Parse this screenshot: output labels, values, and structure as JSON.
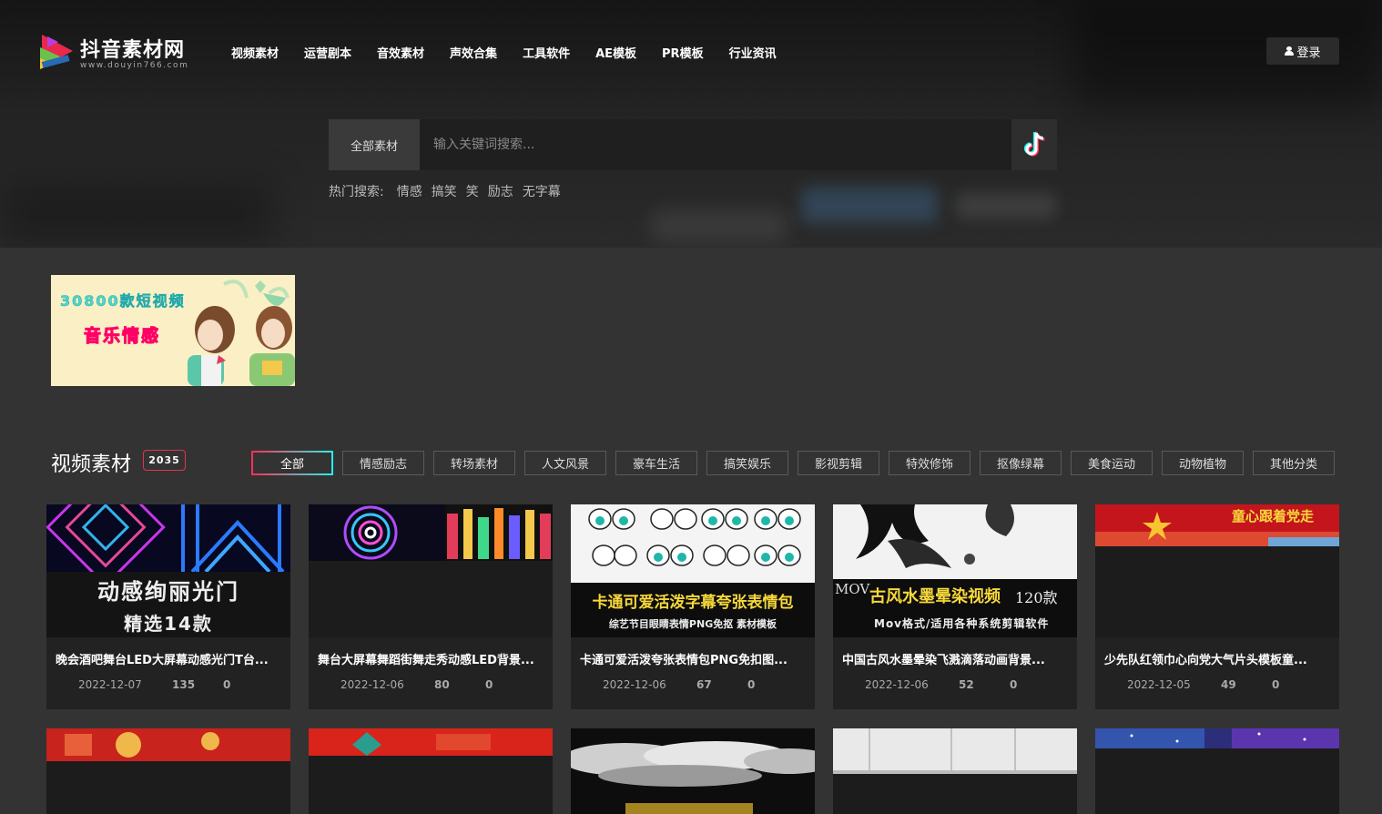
{
  "brand": {
    "title": "抖音素材网",
    "subtitle": "www.douyin766.com"
  },
  "nav": [
    "视频素材",
    "运营剧本",
    "音效素材",
    "声效合集",
    "工具软件",
    "AE模板",
    "PR模板",
    "行业资讯"
  ],
  "login": {
    "label": "登录",
    "icon": "user-icon"
  },
  "search": {
    "category": "全部素材",
    "placeholder": "输入关键词搜索...",
    "button_icon": "tiktok-icon"
  },
  "hot_search": {
    "label": "热门搜索:",
    "items": [
      "情感",
      "搞笑",
      "笑",
      "励志",
      "无字幕"
    ]
  },
  "banner": {
    "line1": "30800款短视频",
    "line2": "音乐情感"
  },
  "section": {
    "title": "视频素材",
    "count": "2035"
  },
  "filters": [
    "全部",
    "情感励志",
    "转场素材",
    "人文风景",
    "豪车生活",
    "搞笑娱乐",
    "影视剪辑",
    "特效修饰",
    "抠像绿幕",
    "美食运动",
    "动物植物",
    "其他分类"
  ],
  "active_filter": "全部",
  "cards": [
    {
      "title": "晚会酒吧舞台LED大屏幕动感光门T台...",
      "date": "2022-12-07",
      "views": "135",
      "likes": "0",
      "caption_big": "动感绚丽光门",
      "caption_small": "精选14款"
    },
    {
      "title": "舞台大屏幕舞蹈街舞走秀动感LED背景...",
      "date": "2022-12-06",
      "views": "80",
      "likes": "0"
    },
    {
      "title": "卡通可爱活泼夸张表情包PNG免扣图...",
      "date": "2022-12-06",
      "views": "67",
      "likes": "0",
      "caption_big": "卡通可爱活泼字幕夸张表情包",
      "caption_small": "综艺节目眼睛表情PNG免抠 素材模板"
    },
    {
      "title": "中国古风水墨晕染飞溅滴落动画背景...",
      "date": "2022-12-06",
      "views": "52",
      "likes": "0",
      "caption_mov": "MOV",
      "caption_big": "古风水墨晕染视频",
      "caption_count": "120款",
      "caption_small": "Mov格式/适用各种系统剪辑软件"
    },
    {
      "title": "少先队红领巾心向党大气片头模板童...",
      "date": "2022-12-05",
      "views": "49",
      "likes": "0",
      "caption_big": "童心跟着党走"
    }
  ],
  "colors": {
    "accent_red": "#ff2d55",
    "accent_cyan": "#25f4ee",
    "badge_border": "#e3344c",
    "page_bg": "#333334",
    "card_bg": "#222223"
  }
}
